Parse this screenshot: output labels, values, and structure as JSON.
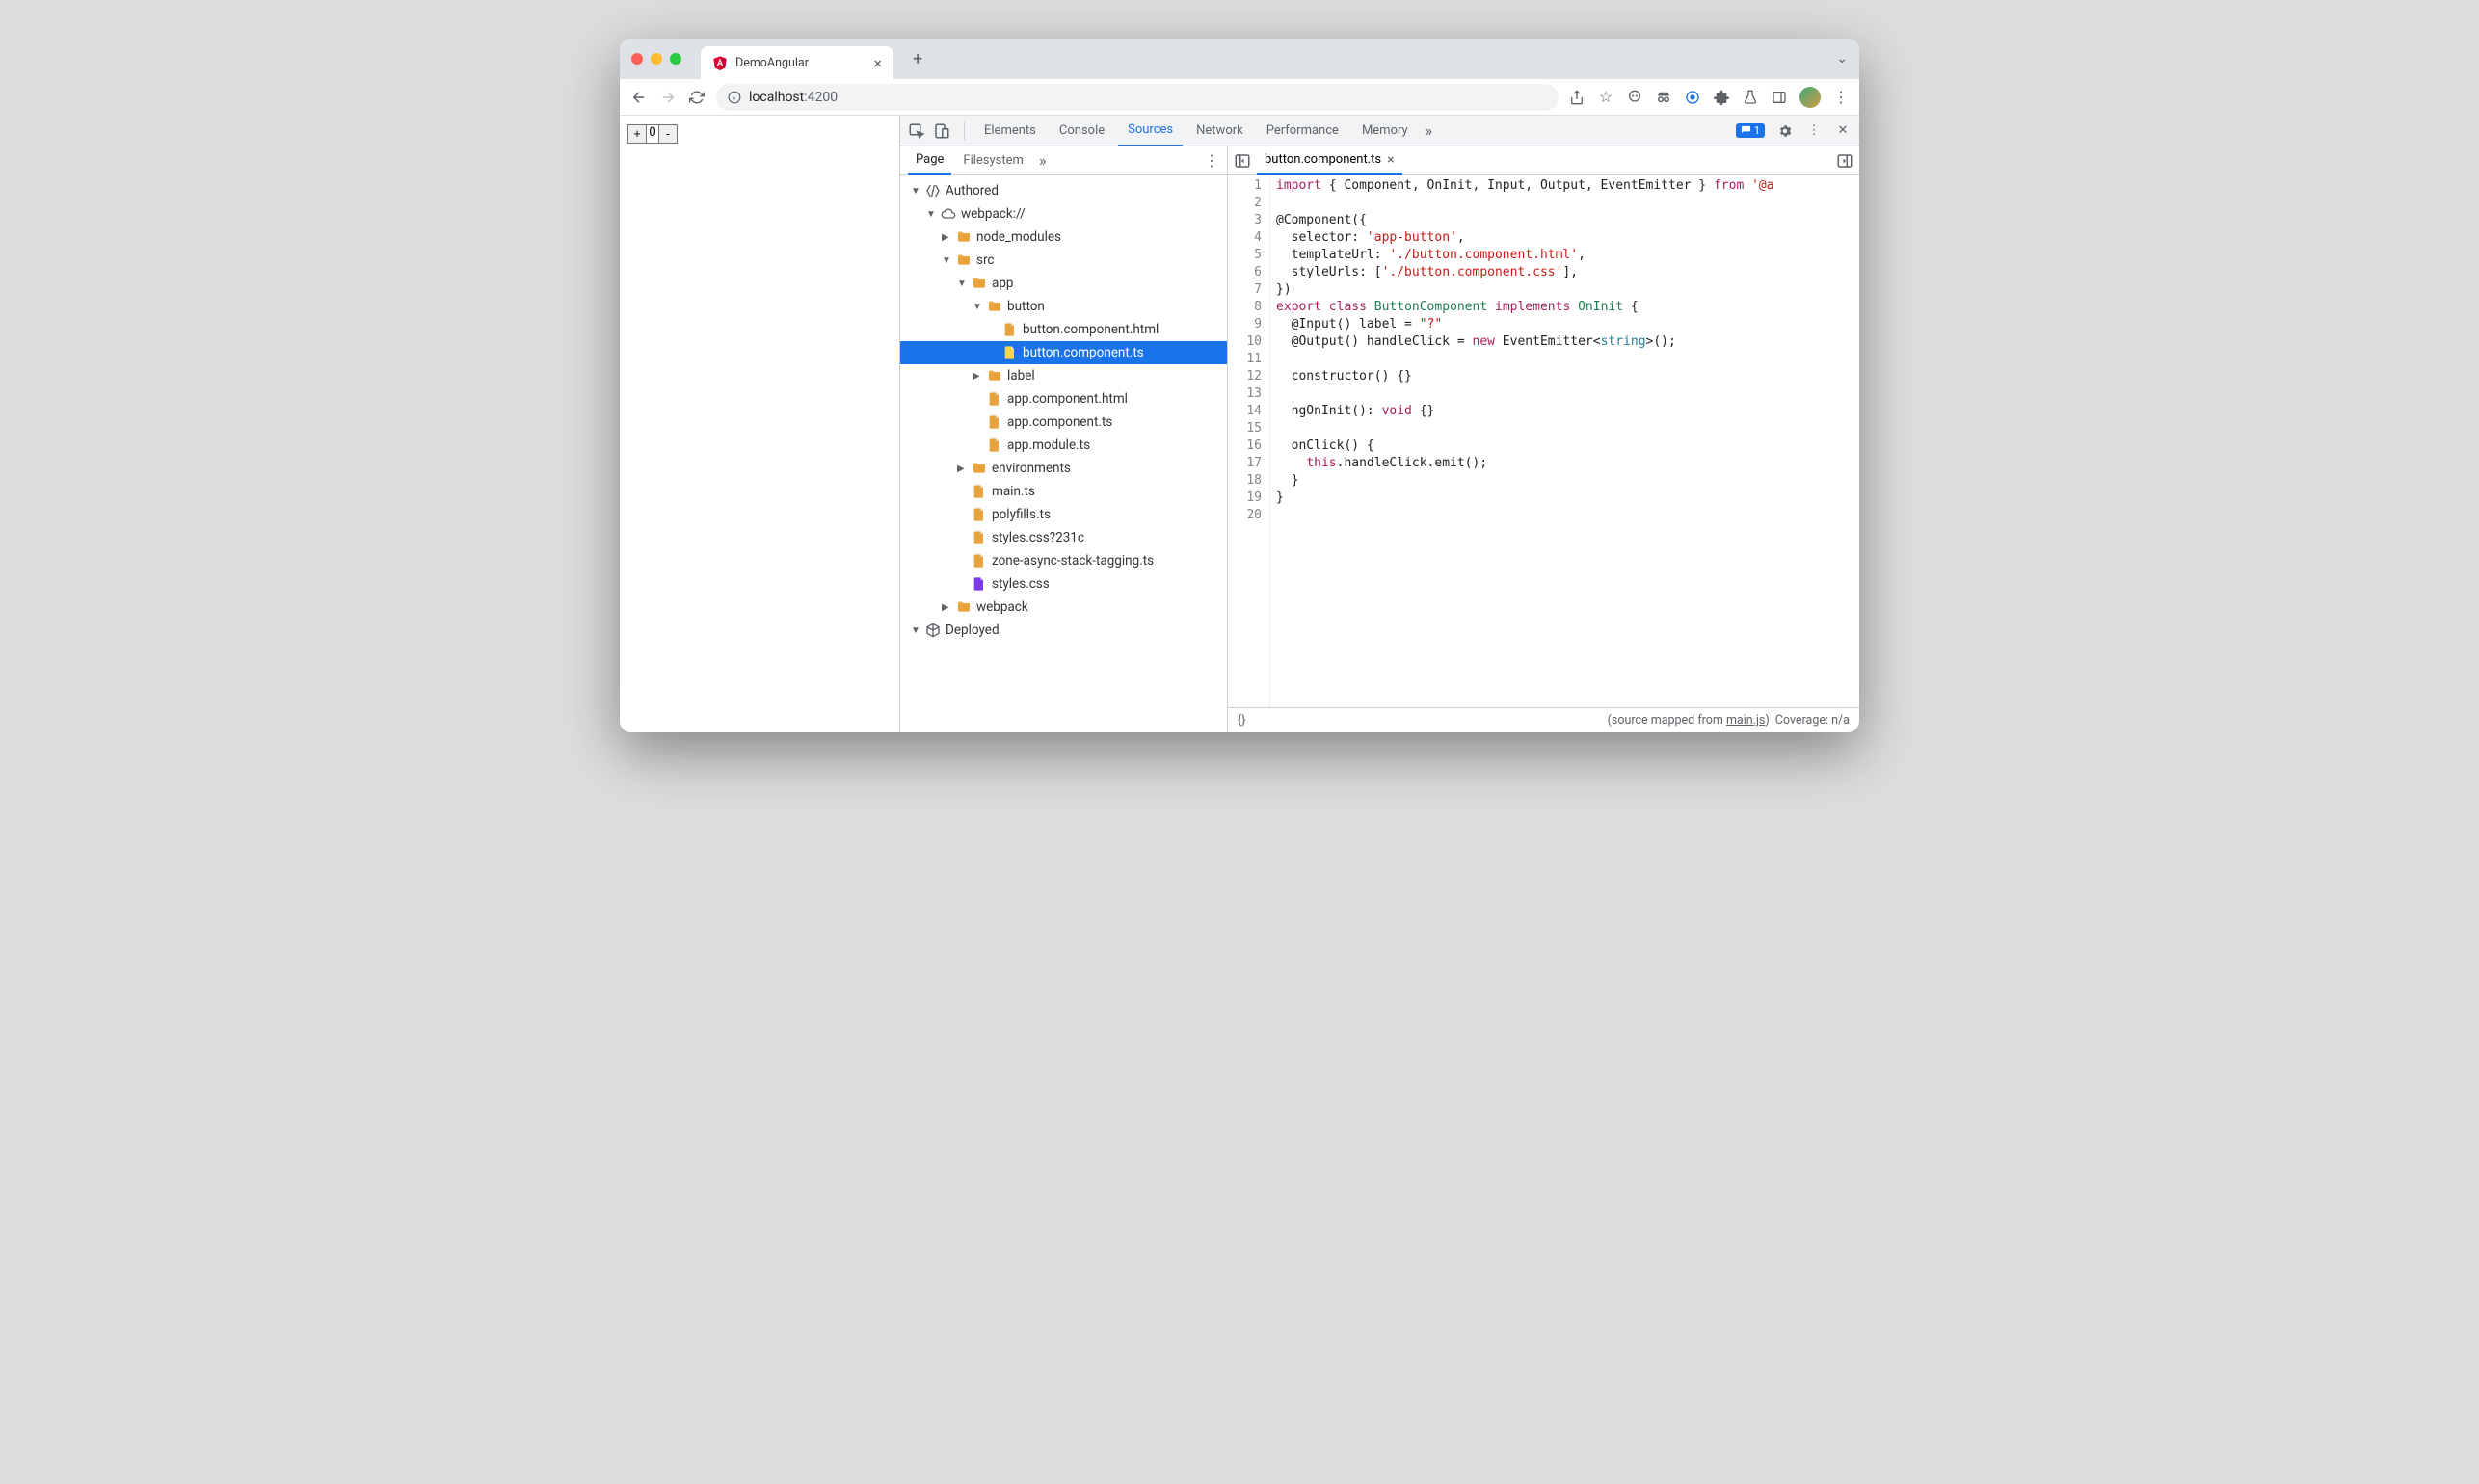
{
  "browser": {
    "tab_title": "DemoAngular",
    "url_host": "localhost",
    "url_port": ":4200",
    "new_tab": "+",
    "close_tab": "×"
  },
  "page": {
    "counter_minus": "-",
    "counter_plus": "+",
    "counter_value": "0"
  },
  "devtools": {
    "tabs": [
      "Elements",
      "Console",
      "Sources",
      "Network",
      "Performance",
      "Memory"
    ],
    "active_tab": "Sources",
    "more": "»",
    "issue_count": "1",
    "sources_nav_tabs": [
      "Page",
      "Filesystem"
    ],
    "sources_nav_active": "Page",
    "sources_nav_more": "»",
    "kebab": "⋮"
  },
  "tree": [
    {
      "type": "group",
      "label": "Authored",
      "icon": "authored",
      "depth": 0,
      "open": true
    },
    {
      "type": "group",
      "label": "webpack://",
      "icon": "cloud",
      "depth": 1,
      "open": true
    },
    {
      "type": "folder",
      "label": "node_modules",
      "depth": 2,
      "open": false
    },
    {
      "type": "folder",
      "label": "src",
      "depth": 2,
      "open": true
    },
    {
      "type": "folder",
      "label": "app",
      "depth": 3,
      "open": true
    },
    {
      "type": "folder",
      "label": "button",
      "depth": 4,
      "open": true
    },
    {
      "type": "file",
      "label": "button.component.html",
      "icon": "orange",
      "depth": 5
    },
    {
      "type": "file",
      "label": "button.component.ts",
      "icon": "orange",
      "depth": 5,
      "selected": true
    },
    {
      "type": "folder",
      "label": "label",
      "depth": 4,
      "open": false
    },
    {
      "type": "file",
      "label": "app.component.html",
      "icon": "orange",
      "depth": 4
    },
    {
      "type": "file",
      "label": "app.component.ts",
      "icon": "orange",
      "depth": 4
    },
    {
      "type": "file",
      "label": "app.module.ts",
      "icon": "orange",
      "depth": 4
    },
    {
      "type": "folder",
      "label": "environments",
      "depth": 3,
      "open": false
    },
    {
      "type": "file",
      "label": "main.ts",
      "icon": "orange",
      "depth": 3
    },
    {
      "type": "file",
      "label": "polyfills.ts",
      "icon": "orange",
      "depth": 3
    },
    {
      "type": "file",
      "label": "styles.css?231c",
      "icon": "orange",
      "depth": 3
    },
    {
      "type": "file",
      "label": "zone-async-stack-tagging.ts",
      "icon": "orange",
      "depth": 3
    },
    {
      "type": "file",
      "label": "styles.css",
      "icon": "purple",
      "depth": 3
    },
    {
      "type": "folder",
      "label": "webpack",
      "depth": 2,
      "open": false
    },
    {
      "type": "group",
      "label": "Deployed",
      "icon": "deployed",
      "depth": 0,
      "open": true
    }
  ],
  "editor": {
    "open_file": "button.component.ts",
    "close": "×",
    "lines": 20,
    "status_left": "{}",
    "status_mapped": "(source mapped from ",
    "status_mapped_link": "main.js",
    "status_mapped_close": ")",
    "status_coverage": "Coverage: n/a"
  },
  "code": {
    "l1_a": "import",
    "l1_b": " { Component, OnInit, Input, Output, EventEmitter } ",
    "l1_c": "from",
    "l1_d": " '@a",
    "l3": "@Component({",
    "l4_a": "  selector: ",
    "l4_b": "'app-button'",
    "l4_c": ",",
    "l5_a": "  templateUrl: ",
    "l5_b": "'./button.component.html'",
    "l5_c": ",",
    "l6_a": "  styleUrls: [",
    "l6_b": "'./button.component.css'",
    "l6_c": "],",
    "l7": "})",
    "l8_a": "export",
    "l8_b": " class ",
    "l8_c": "ButtonComponent",
    "l8_d": " implements ",
    "l8_e": "OnInit",
    "l8_f": " {",
    "l9_a": "  @Input() label = ",
    "l9_b": "\"?\"",
    "l10_a": "  @Output() handleClick = ",
    "l10_b": "new",
    "l10_c": " EventEmitter<",
    "l10_d": "string",
    "l10_e": ">();",
    "l12": "  constructor() {}",
    "l14_a": "  ngOnInit(): ",
    "l14_b": "void",
    "l14_c": " {}",
    "l16": "  onClick() {",
    "l17_a": "    ",
    "l17_b": "this",
    "l17_c": ".handleClick.emit();",
    "l18": "  }",
    "l19": "}"
  }
}
